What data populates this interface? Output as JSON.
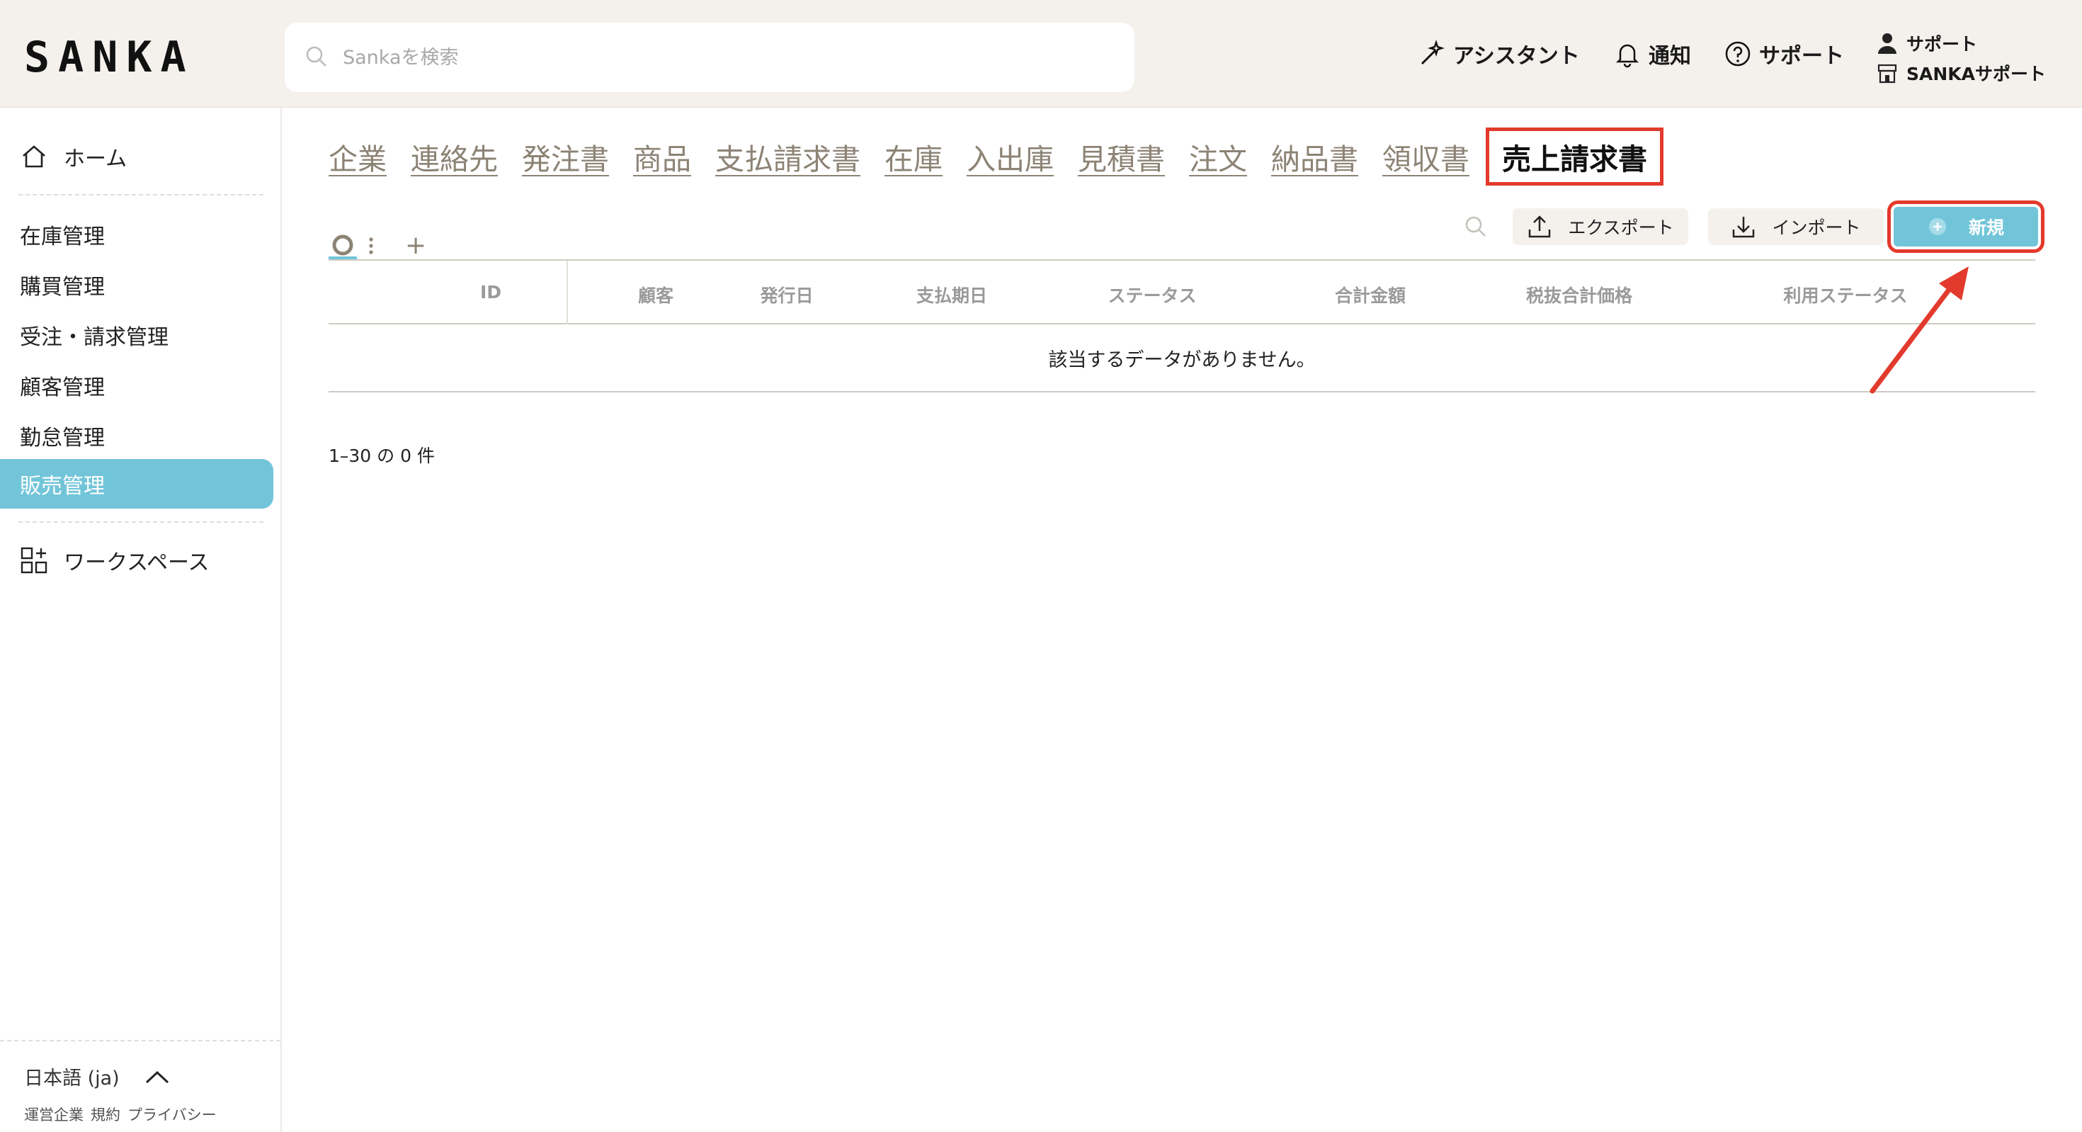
{
  "header": {
    "logo": "SANKA",
    "search_placeholder": "Sankaを検索",
    "assistant_label": "アシスタント",
    "notification_label": "通知",
    "support_label": "サポート",
    "user_name": "サポート",
    "workspace_name": "SANKAサポート"
  },
  "sidebar": {
    "home": "ホーム",
    "items": [
      {
        "label": "在庫管理"
      },
      {
        "label": "購買管理"
      },
      {
        "label": "受注・請求管理"
      },
      {
        "label": "顧客管理"
      },
      {
        "label": "勤怠管理"
      },
      {
        "label": "販売管理"
      }
    ],
    "workspace": "ワークスペース",
    "language": "日本語 (ja)",
    "footer_links": [
      "運営企業",
      "規約",
      "プライバシー"
    ]
  },
  "tabs": [
    {
      "label": "企業"
    },
    {
      "label": "連絡先"
    },
    {
      "label": "発注書"
    },
    {
      "label": "商品"
    },
    {
      "label": "支払請求書"
    },
    {
      "label": "在庫"
    },
    {
      "label": "入出庫"
    },
    {
      "label": "見積書"
    },
    {
      "label": "注文"
    },
    {
      "label": "納品書"
    },
    {
      "label": "領収書"
    },
    {
      "label": "売上請求書"
    }
  ],
  "toolbar": {
    "add_view": "+",
    "export_label": "エクスポート",
    "import_label": "インポート",
    "new_label": "新規"
  },
  "table": {
    "columns": [
      "ID",
      "顧客",
      "発行日",
      "支払期日",
      "ステータス",
      "合計金額",
      "税抜合計価格",
      "利用ステータス"
    ],
    "empty_message": "該当するデータがありません。"
  },
  "pagination": "1–30 の 0 件",
  "colors": {
    "accent": "#72c5d9",
    "highlight": "#e23a2c",
    "header_bg": "#f4f1ed",
    "tab_text": "#8c8375"
  }
}
